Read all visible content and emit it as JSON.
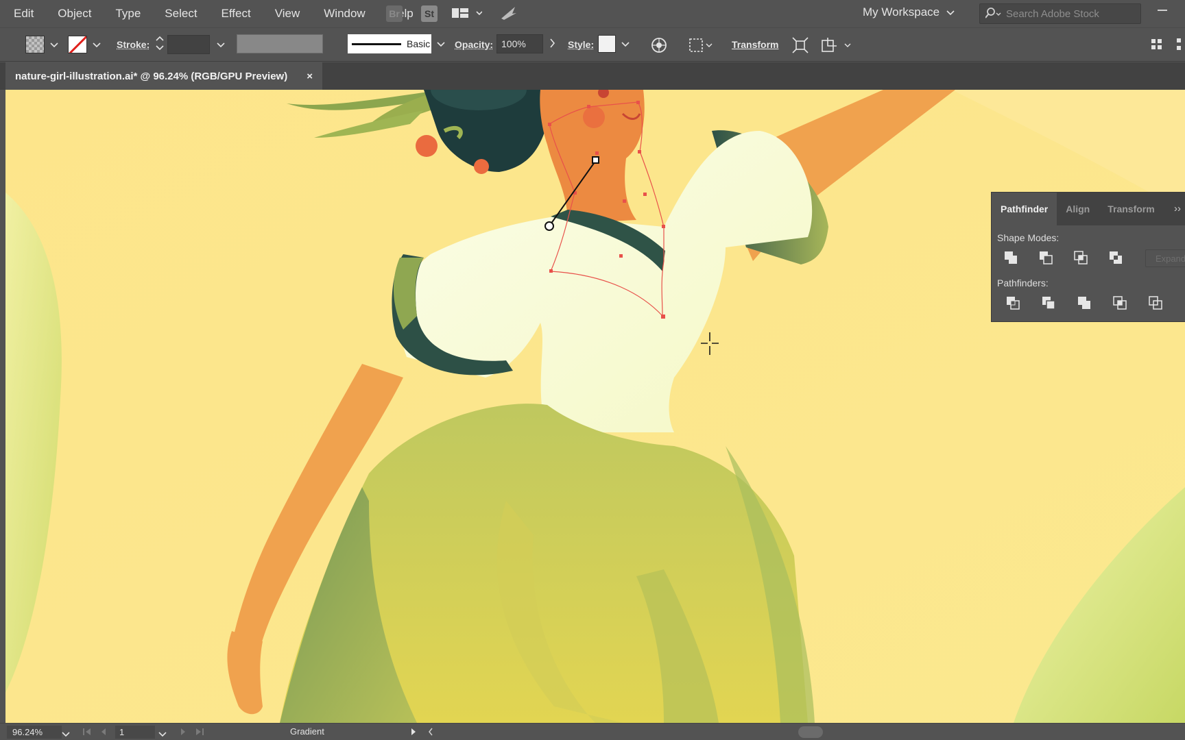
{
  "menu": {
    "items": [
      "Edit",
      "Object",
      "Type",
      "Select",
      "Effect",
      "View",
      "Window",
      "Help"
    ],
    "bridge_label": "Br",
    "stock_label": "St",
    "workspace_label": "My Workspace",
    "search_placeholder": "Search Adobe Stock"
  },
  "control": {
    "stroke_label": "Stroke:",
    "stroke_value": "",
    "brush_label": "Basic",
    "opacity_label": "Opacity:",
    "opacity_value": "100%",
    "style_label": "Style:",
    "transform_label": "Transform"
  },
  "document": {
    "tab_title": "nature-girl-illustration.ai* @ 96.24% (RGB/GPU Preview)",
    "close_glyph": "×"
  },
  "pathfinder": {
    "tabs": [
      "Pathfinder",
      "Align",
      "Transform"
    ],
    "active_tab": "Pathfinder",
    "menu_glyph": "››",
    "shape_modes_label": "Shape Modes:",
    "pathfinders_label": "Pathfinders:",
    "expand_label": "Expand",
    "shape_mode_icons": [
      "unite-icon",
      "minus-front-icon",
      "intersect-icon",
      "exclude-icon"
    ],
    "pathfinder_icons": [
      "divide-icon",
      "trim-icon",
      "merge-icon",
      "crop-icon",
      "outline-icon"
    ]
  },
  "status": {
    "zoom": "96.24%",
    "artboard": "1",
    "current_tool": "Gradient"
  },
  "colors": {
    "ui_bg": "#535353",
    "canvas_bg": "#fbe58a",
    "skin": "#f0a24e",
    "blouse": "#f7fbdf",
    "skirt": "#c7c95a",
    "dark_green": "#2f5347",
    "selection": "#e8514a"
  }
}
